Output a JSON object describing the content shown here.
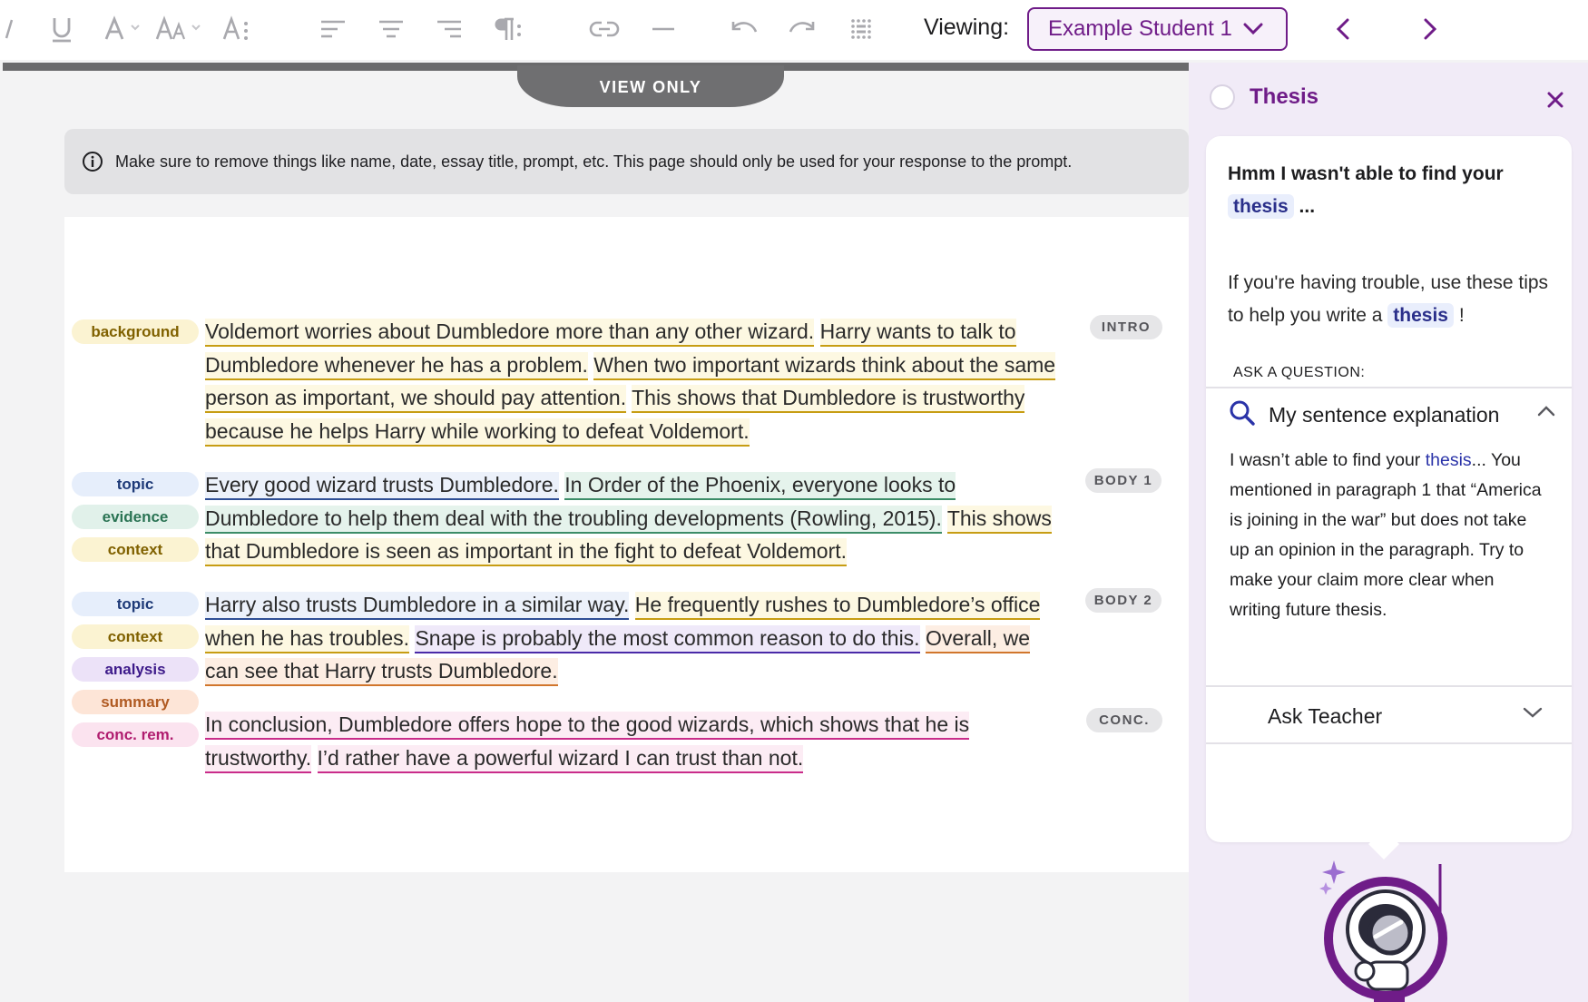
{
  "toolbar": {
    "tools": [
      "italic-icon",
      "underline-icon",
      "font-color-icon",
      "font-size-icon",
      "line-spacing-icon",
      "align-left-icon",
      "align-center-icon",
      "align-right-icon",
      "paragraph-icon",
      "link-icon",
      "horizontal-rule-icon",
      "undo-icon",
      "redo-icon",
      "table-icon"
    ],
    "viewing_label": "Viewing:",
    "student": "Example Student 1"
  },
  "editor": {
    "view_only": "VIEW ONLY",
    "notice": "Make sure to remove things like name, date, essay title, prompt, etc. This page should only be used for your response to the prompt."
  },
  "tags": {
    "background": "background",
    "topic": "topic",
    "evidence": "evidence",
    "context": "context",
    "analysis": "analysis",
    "summary": "summary",
    "conc": "conc. rem."
  },
  "sections": {
    "intro": "INTRO",
    "body1": "BODY 1",
    "body2": "BODY 2",
    "conc": "CONC."
  },
  "paragraphs": {
    "intro": [
      "Voldemort worries about Dumbledore more than any other wizard.",
      "Harry wants to talk to Dumbledore whenever he has a problem.",
      "When two important wizards think about the same person as important, we should pay attention.",
      "This shows that Dumbledore is trustworthy because he helps Harry while working to defeat Voldemort."
    ],
    "body1": [
      "Every good wizard trusts Dumbledore.",
      "In Order of the Phoenix, everyone looks to Dumbledore to help them deal with the troubling developments (Rowling, 2015).",
      "This shows that Dumbledore is seen as important in the fight to defeat Voldemort."
    ],
    "body2": [
      "Harry also trusts Dumbledore in a similar way.",
      "He frequently rushes to Dumbledore’s office when he has troubles.",
      "Snape is probably the most common reason to do this.",
      "Overall, we can see that Harry trusts Dumbledore."
    ],
    "conc": [
      "In conclusion, Dumbledore offers hope to the good wizards, which shows that he is trustworthy.",
      "I’d rather have a powerful wizard I can trust than not."
    ]
  },
  "panel": {
    "title": "Thesis",
    "heading_pre": "Hmm I wasn't able to find your",
    "heading_keyword": "thesis",
    "heading_post": "...",
    "tip_pre": "If you're having trouble, use these tips to help you write a",
    "tip_keyword": "thesis",
    "tip_post": "!",
    "ask_label": "ASK A QUESTION:",
    "question": "My sentence explanation",
    "explain_pre": "I wasn’t able to find your",
    "explain_keyword": "thesis",
    "explain_post": "... You mentioned in paragraph 1 that “America is joining in the war” but does not take up an opinion in the paragraph. Try to make your claim more clear when writing future thesis.",
    "ask_teacher": "Ask Teacher"
  },
  "colors": {
    "brand_purple": "#6f1c88",
    "panel_bg": "#f1ebf7",
    "keyword_blue": "#2a33a8"
  }
}
